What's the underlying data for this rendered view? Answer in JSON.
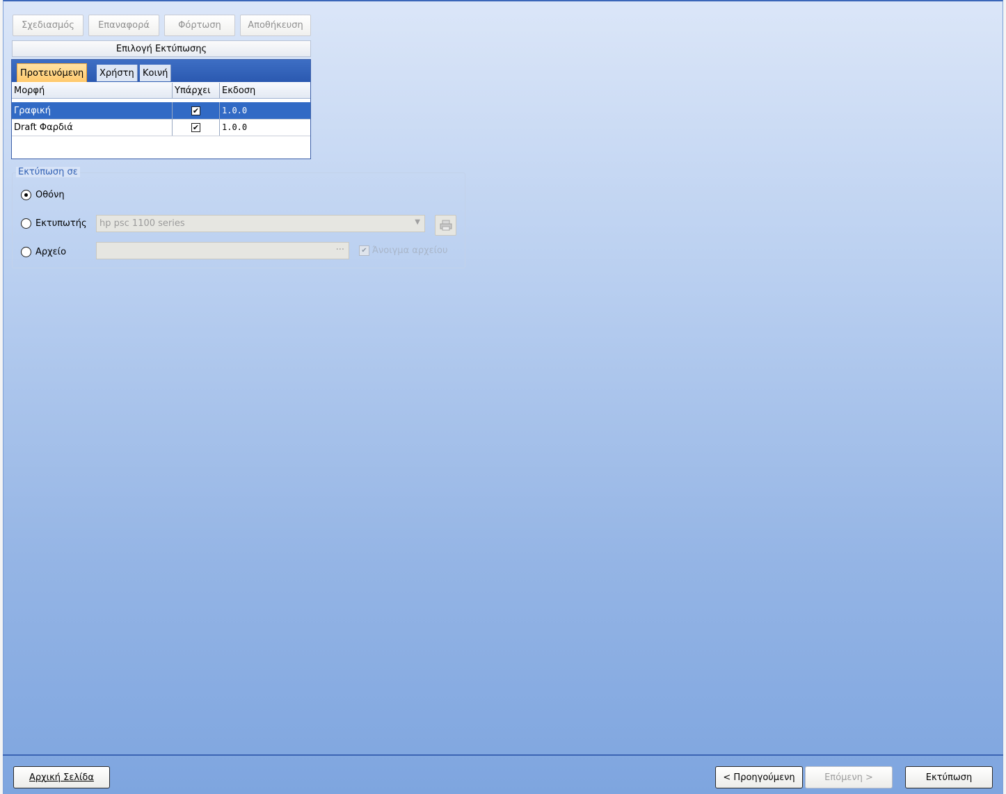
{
  "toolbar": {
    "design_label": "Σχεδιασμός",
    "reset_label": "Επαναφορά",
    "load_label": "Φόρτωση",
    "save_label": "Αποθήκευση"
  },
  "print_selection": {
    "title": "Επιλογή Εκτύπωσης",
    "tabs": [
      {
        "label": "Προτεινόμενη",
        "active": true
      },
      {
        "label": "Χρήστη",
        "active": false
      },
      {
        "label": "Κοινή",
        "active": false
      }
    ],
    "columns": [
      "Μορφή",
      "Υπάρχει",
      "Εκδοση"
    ],
    "rows": [
      {
        "format": "Γραφική",
        "exists": true,
        "version": "1.0.0",
        "selected": true
      },
      {
        "format": "Draft Φαρδιά",
        "exists": true,
        "version": "1.0.0",
        "selected": false
      }
    ]
  },
  "print_to": {
    "title": "Εκτύπωση σε",
    "screen_label": "Οθόνη",
    "printer_label": "Εκτυπωτής",
    "printer_value": "hp psc 1100 series",
    "file_label": "Αρχείο",
    "file_value": "",
    "browse_label": "···",
    "open_file_label": "Άνοιγμα αρχείου",
    "selected": "screen"
  },
  "footer": {
    "home_label": "Αρχική Σελίδα",
    "prev_label": "< Προηγούμενη",
    "next_label": "Επόμενη >",
    "print_label": "Εκτύπωση"
  },
  "colors": {
    "accent": "#316ac5",
    "tab_active": "#ffc86a",
    "group_title": "#2f5fb3"
  }
}
